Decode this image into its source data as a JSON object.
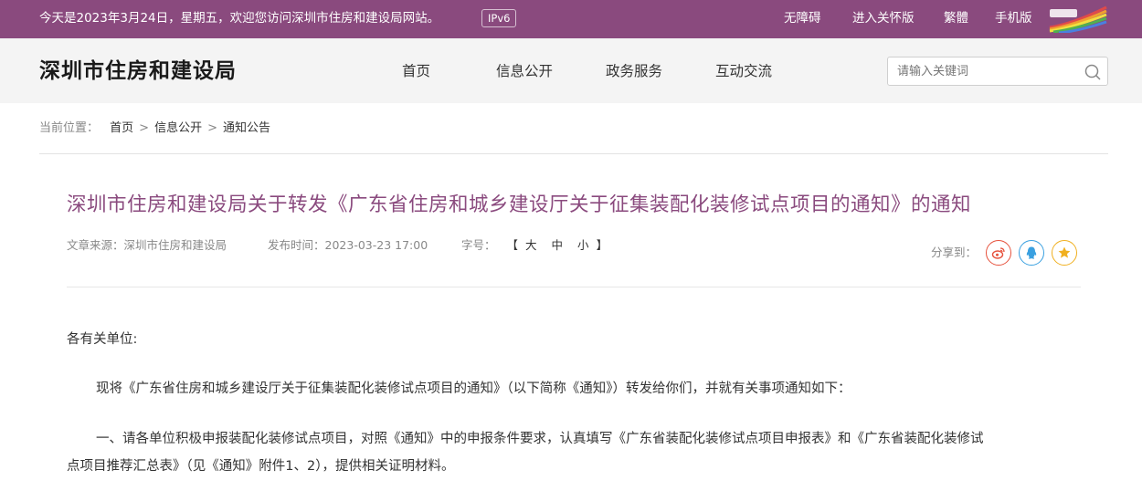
{
  "topbar": {
    "welcome": "今天是2023年3月24日，星期五，欢迎您访问深圳市住房和建设局网站。",
    "ipv6": "IPv6",
    "links": [
      "无障碍",
      "进入关怀版",
      "繁體",
      "手机版"
    ]
  },
  "header": {
    "site_title": "深圳市住房和建设局",
    "nav": [
      "首页",
      "信息公开",
      "政务服务",
      "互动交流"
    ],
    "search_placeholder": "请输入关键词"
  },
  "breadcrumb": {
    "label": "当前位置：",
    "items": [
      "首页",
      "信息公开",
      "通知公告"
    ],
    "separator": ">"
  },
  "article": {
    "title": "深圳市住房和建设局关于转发《广东省住房和城乡建设厅关于征集装配化装修试点项目的通知》的通知",
    "source_label": "文章来源：",
    "source": "深圳市住房和建设局",
    "date_label": "发布时间：",
    "date": "2023-03-23 17:00",
    "fontsize_label": "字号：",
    "fontsize_open": "【",
    "fontsize_options": [
      "大",
      "中",
      "小"
    ],
    "fontsize_close": "】",
    "share_label": "分享到："
  },
  "body": {
    "salutation": "各有关单位:",
    "p1": "现将《广东省住房和城乡建设厅关于征集装配化装修试点项目的通知》（以下简称《通知》）转发给你们，并就有关事项通知如下：",
    "p2_line1": "一、请各单位积极申报装配化装修试点项目，对照《通知》中的申报条件要求，认真填写《广东省装配化装修试点项目申报表》和《广东省装配化装修试",
    "p2_line2": "点项目推荐汇总表》（见《通知》附件1、2），提供相关证明材料。"
  },
  "colors": {
    "brand": "#8a4a7e",
    "weibo": "#e6513c",
    "qq": "#3aa0e0",
    "qzone": "#f0b020"
  }
}
